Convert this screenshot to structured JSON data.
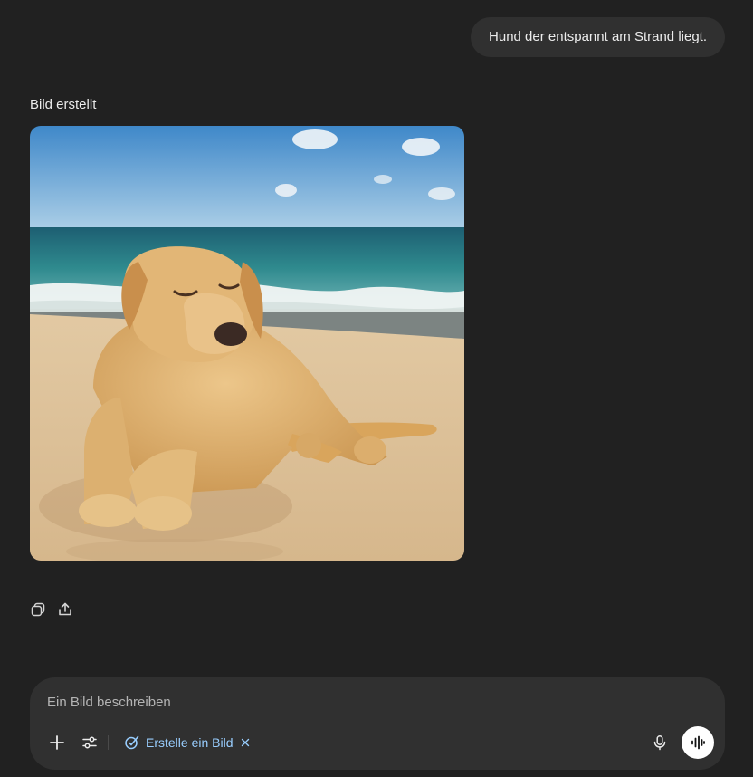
{
  "conversation": {
    "user_message": "Hund der entspannt am Strand liegt.",
    "assistant_status": "Bild erstellt"
  },
  "actions": {
    "copy_icon": "copy-icon",
    "share_icon": "share-icon"
  },
  "composer": {
    "placeholder": "Ein Bild beschreiben",
    "value": "",
    "tool_chip_label": "Erstelle ein Bild",
    "accent_color": "#99ceff"
  },
  "colors": {
    "background": "#212121",
    "bubble": "#303030",
    "text": "#ececec"
  }
}
